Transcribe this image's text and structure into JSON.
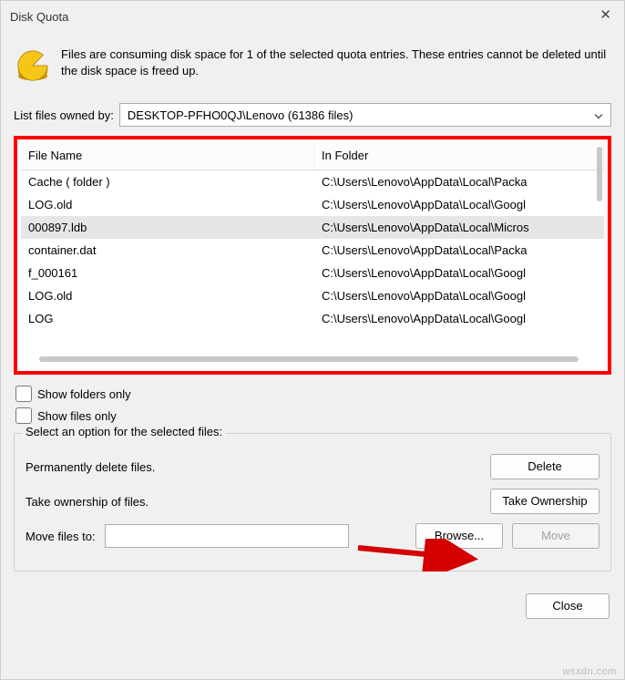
{
  "window": {
    "title": "Disk Quota"
  },
  "info_text": "Files are consuming disk space for 1 of the selected quota entries.  These entries cannot be deleted until the disk space is freed up.",
  "owned_label": "List files owned by:",
  "owned_value": "DESKTOP-PFHO0QJ\\Lenovo (61386 files)",
  "columns": {
    "name": "File Name",
    "folder": "In Folder"
  },
  "rows": [
    {
      "name": "Cache  ( folder )",
      "folder": "C:\\Users\\Lenovo\\AppData\\Local\\Packa",
      "sel": false
    },
    {
      "name": "LOG.old",
      "folder": "C:\\Users\\Lenovo\\AppData\\Local\\Googl",
      "sel": false
    },
    {
      "name": "000897.ldb",
      "folder": "C:\\Users\\Lenovo\\AppData\\Local\\Micros",
      "sel": true
    },
    {
      "name": "container.dat",
      "folder": "C:\\Users\\Lenovo\\AppData\\Local\\Packa",
      "sel": false
    },
    {
      "name": "f_000161",
      "folder": "C:\\Users\\Lenovo\\AppData\\Local\\Googl",
      "sel": false
    },
    {
      "name": "LOG.old",
      "folder": "C:\\Users\\Lenovo\\AppData\\Local\\Googl",
      "sel": false
    },
    {
      "name": "LOG",
      "folder": "C:\\Users\\Lenovo\\AppData\\Local\\Googl",
      "sel": false
    }
  ],
  "checkboxes": {
    "folders_only": "Show folders only",
    "files_only": "Show files only"
  },
  "group": {
    "title": "Select an option for the selected files:",
    "perm_delete": "Permanently delete files.",
    "take_ownership": "Take ownership of files.",
    "move_label": "Move files to:",
    "buttons": {
      "delete": "Delete",
      "take": "Take Ownership",
      "browse": "Browse...",
      "move": "Move"
    }
  },
  "close_btn": "Close",
  "watermark": "wsxdn.com"
}
